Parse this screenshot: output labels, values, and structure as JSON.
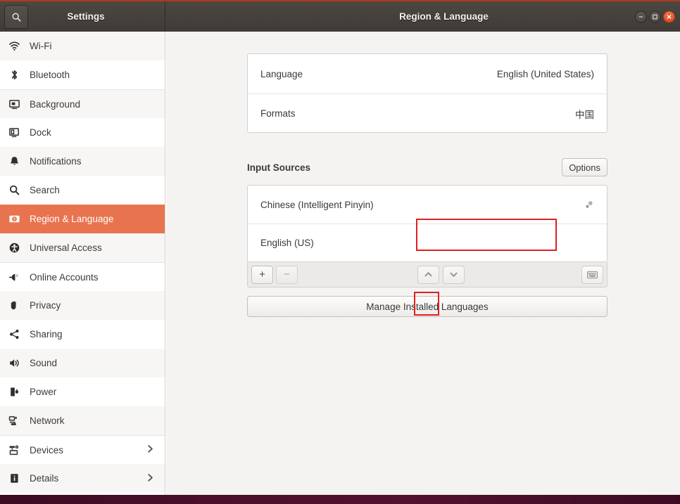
{
  "titlebar": {
    "app_title": "Settings",
    "page_title": "Region & Language",
    "search_icon": "search-icon",
    "minimize_label": "–",
    "maximize_label": "□",
    "close_label": "×"
  },
  "sidebar": {
    "items": [
      {
        "label": "Wi-Fi",
        "icon": "wifi-icon",
        "active": false,
        "chevron": false
      },
      {
        "label": "Bluetooth",
        "icon": "bluetooth-icon",
        "active": false,
        "chevron": false
      },
      {
        "label": "Background",
        "icon": "background-icon",
        "active": false,
        "chevron": false
      },
      {
        "label": "Dock",
        "icon": "dock-icon",
        "active": false,
        "chevron": false
      },
      {
        "label": "Notifications",
        "icon": "bell-icon",
        "active": false,
        "chevron": false
      },
      {
        "label": "Search",
        "icon": "search-icon",
        "active": false,
        "chevron": false
      },
      {
        "label": "Region & Language",
        "icon": "region-language-icon",
        "active": true,
        "chevron": false
      },
      {
        "label": "Universal Access",
        "icon": "accessibility-icon",
        "active": false,
        "chevron": false
      },
      {
        "label": "Online Accounts",
        "icon": "online-accounts-icon",
        "active": false,
        "chevron": false
      },
      {
        "label": "Privacy",
        "icon": "hand-privacy-icon",
        "active": false,
        "chevron": false
      },
      {
        "label": "Sharing",
        "icon": "share-icon",
        "active": false,
        "chevron": false
      },
      {
        "label": "Sound",
        "icon": "speaker-icon",
        "active": false,
        "chevron": false
      },
      {
        "label": "Power",
        "icon": "battery-power-icon",
        "active": false,
        "chevron": false
      },
      {
        "label": "Network",
        "icon": "network-icon",
        "active": false,
        "chevron": false
      },
      {
        "label": "Devices",
        "icon": "devices-icon",
        "active": false,
        "chevron": true
      },
      {
        "label": "Details",
        "icon": "info-icon",
        "active": false,
        "chevron": true
      }
    ]
  },
  "main": {
    "language_rows": [
      {
        "label": "Language",
        "value": "English (United States)"
      },
      {
        "label": "Formats",
        "value": "中国"
      }
    ],
    "input_sources": {
      "section_title": "Input Sources",
      "options_label": "Options",
      "sources": [
        {
          "label": "Chinese (Intelligent Pinyin)",
          "has_settings": true
        },
        {
          "label": "English (US)",
          "has_settings": false
        }
      ],
      "toolbar": {
        "add_label": "+",
        "remove_label": "−",
        "move_up_icon": "chevron-up-icon",
        "move_down_icon": "chevron-down-icon",
        "keyboard_icon": "keyboard-icon"
      }
    },
    "manage_languages_label": "Manage Installed Languages"
  },
  "annotations": [
    {
      "name": "highlight-chinese-input-source"
    },
    {
      "name": "highlight-add-input-source-button"
    }
  ],
  "colors": {
    "accent_orange": "#e8744f",
    "titlebar_dark": "#403b37",
    "titlebar_top_border": "#b03a1b",
    "close_button": "#de4c21",
    "annotation_red": "#e02020",
    "bottom_strip": "#4a0f2b"
  }
}
